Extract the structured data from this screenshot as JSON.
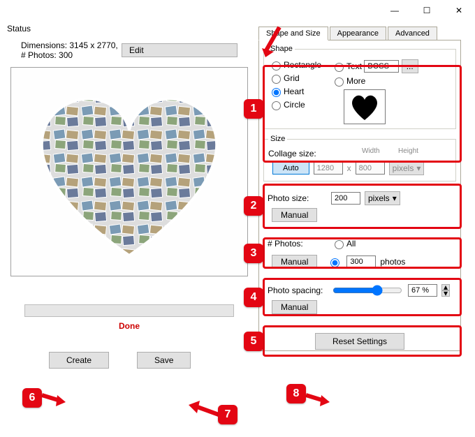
{
  "titlebar": {
    "minimize": "—",
    "maximize": "☐",
    "close": "✕"
  },
  "status": {
    "label": "Status",
    "dimensions": "Dimensions: 3145 x 2770, # Photos: 300",
    "edit": "Edit",
    "done": "Done",
    "create": "Create",
    "save": "Save"
  },
  "tabs": {
    "shape": "Shape and Size",
    "appearance": "Appearance",
    "advanced": "Advanced"
  },
  "shape": {
    "legend": "Shape",
    "rectangle": "Rectangle",
    "grid": "Grid",
    "heart": "Heart",
    "circle": "Circle",
    "text": "Text",
    "textValue": "BOSS",
    "browse": "...",
    "more": "More"
  },
  "size": {
    "legend": "Size",
    "collageSize": "Collage size:",
    "auto": "Auto",
    "widthLabel": "Width",
    "heightLabel": "Height",
    "width": "1280",
    "height": "800",
    "x": "x",
    "units": "pixels"
  },
  "photoSize": {
    "label": "Photo size:",
    "mode": "Manual",
    "value": "200",
    "units": "pixels"
  },
  "numPhotos": {
    "label": "# Photos:",
    "mode": "Manual",
    "all": "All",
    "value": "300",
    "suffix": "photos"
  },
  "spacing": {
    "label": "Photo spacing:",
    "mode": "Manual",
    "value": "67 %"
  },
  "reset": "Reset Settings",
  "callouts": {
    "c1": "1",
    "c2": "2",
    "c3": "3",
    "c4": "4",
    "c5": "5",
    "c6": "6",
    "c7": "7",
    "c8": "8"
  }
}
